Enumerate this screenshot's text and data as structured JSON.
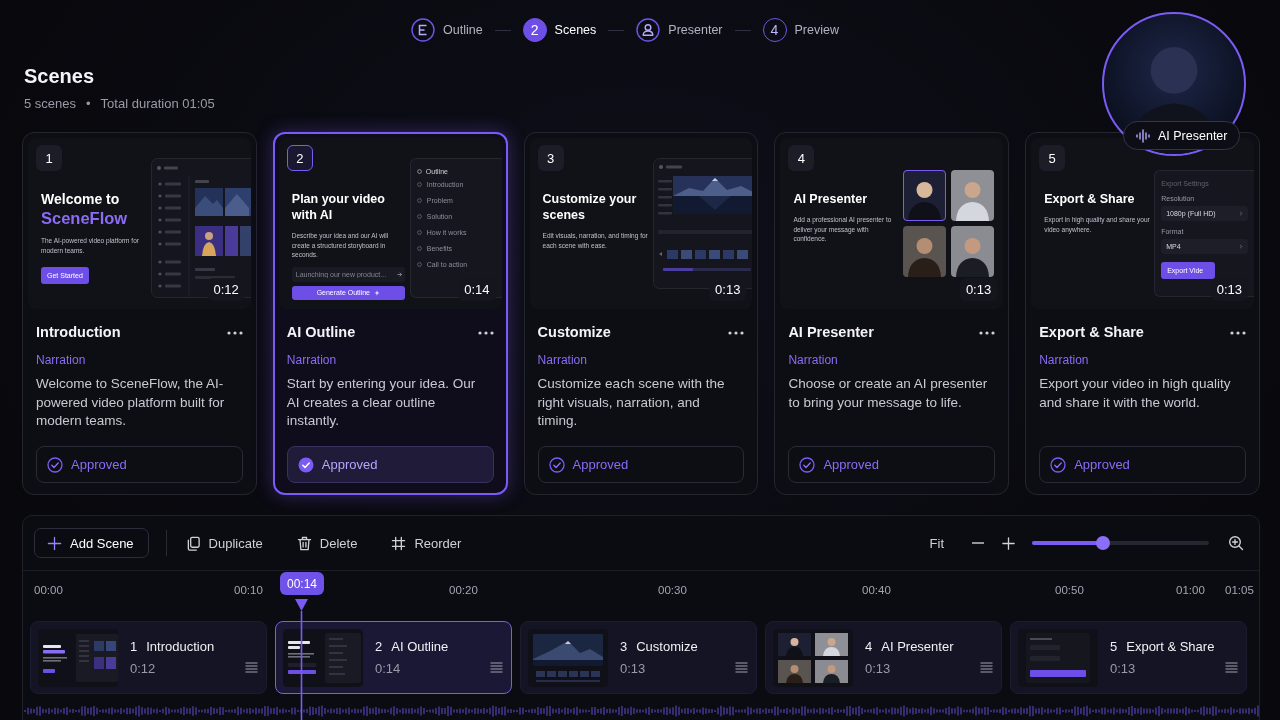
{
  "stepper": {
    "steps": [
      {
        "label": "Outline",
        "kind": "icon",
        "selected": false
      },
      {
        "label": "Scenes",
        "kind": "number",
        "number": "2",
        "selected": true
      },
      {
        "label": "Presenter",
        "kind": "icon",
        "selected": false
      },
      {
        "label": "Preview",
        "kind": "number",
        "number": "4",
        "selected": false
      }
    ]
  },
  "header": {
    "title": "Scenes",
    "scene_count": "5 scenes",
    "separator": "•",
    "total_duration": "Total duration 01:05"
  },
  "presenter_preview": {
    "badge": "AI Presenter"
  },
  "scenes": [
    {
      "number": "1",
      "duration": "0:12",
      "title": "Introduction",
      "narration_label": "Narration",
      "description": "Welcome to SceneFlow, the AI-powered video platform built for modern teams.",
      "status": "Approved",
      "selected": false,
      "preview": {
        "kind": "welcome",
        "heading": "Welcome to",
        "highlight": "SceneFlow",
        "text": "The AI-powered video platform for modern teams.",
        "button": "Get Started"
      }
    },
    {
      "number": "2",
      "duration": "0:14",
      "title": "AI Outline",
      "narration_label": "Narration",
      "description": "Start by entering your idea. Our AI creates a clear outline instantly.",
      "status": "Approved",
      "selected": true,
      "preview": {
        "kind": "outline",
        "heading": "Plan your video with AI",
        "text": "Describe your idea and our AI will create a structured storyboard in seconds.",
        "placeholder": "Launching our new product...",
        "button": "Generate Outline",
        "panel_title": "Outline",
        "items": [
          "Introduction",
          "Problem",
          "Solution",
          "How it works",
          "Benefits",
          "Call to action"
        ]
      }
    },
    {
      "number": "3",
      "duration": "0:13",
      "title": "Customize",
      "narration_label": "Narration",
      "description": "Customize each scene with the right visuals, narration, and timing.",
      "status": "Approved",
      "selected": false,
      "preview": {
        "kind": "customize",
        "heading": "Customize your scenes",
        "text": "Edit visuals, narration, and timing for each scene with ease."
      }
    },
    {
      "number": "4",
      "duration": "0:13",
      "title": "AI Presenter",
      "narration_label": "Narration",
      "description": "Choose or create an AI presenter to bring your message to life.",
      "status": "Approved",
      "selected": false,
      "preview": {
        "kind": "presenter",
        "heading": "AI Presenter",
        "text": "Add a professional AI presenter to deliver your message with confidence.",
        "tiles": [
          {
            "selected": true
          },
          {
            "selected": false
          },
          {
            "selected": false
          },
          {
            "selected": false
          }
        ]
      }
    },
    {
      "number": "5",
      "duration": "0:13",
      "title": "Export & Share",
      "narration_label": "Narration",
      "description": "Export your video in high quality and share it with the world.",
      "status": "Approved",
      "selected": false,
      "preview": {
        "kind": "export",
        "heading": "Export & Share",
        "text": "Export in high quality and share your video anywhere.",
        "panel_title": "Export Settings",
        "fields": [
          {
            "label": "Resolution",
            "value": "1080p (Full HD)"
          },
          {
            "label": "Format",
            "value": "MP4"
          }
        ],
        "button": "Export Vide"
      }
    }
  ],
  "timeline": {
    "toolbar": {
      "buttons": [
        {
          "label": "Add Scene",
          "kind": "outlined"
        },
        {
          "label": "Duplicate",
          "kind": "plain"
        },
        {
          "label": "Delete",
          "kind": "plain"
        },
        {
          "label": "Reorder",
          "kind": "plain"
        }
      ],
      "zoom": {
        "fit": "Fit",
        "level": 0.4
      }
    },
    "ruler": [
      "00:00",
      "00:10",
      "00:20",
      "00:30",
      "00:40",
      "00:50",
      "01:00",
      "01:05"
    ],
    "playhead": "00:14",
    "clips": [
      {
        "number": "1",
        "title": "Introduction",
        "duration": "0:12",
        "kind": "welcome",
        "selected": false
      },
      {
        "number": "2",
        "title": "AI Outline",
        "duration": "0:14",
        "kind": "outline",
        "selected": true
      },
      {
        "number": "3",
        "title": "Customize",
        "duration": "0:13",
        "kind": "customize",
        "selected": false
      },
      {
        "number": "4",
        "title": "AI Presenter",
        "duration": "0:13",
        "kind": "presenter",
        "selected": false
      },
      {
        "number": "5",
        "title": "Export & Share",
        "duration": "0:13",
        "kind": "export",
        "selected": false
      }
    ]
  }
}
